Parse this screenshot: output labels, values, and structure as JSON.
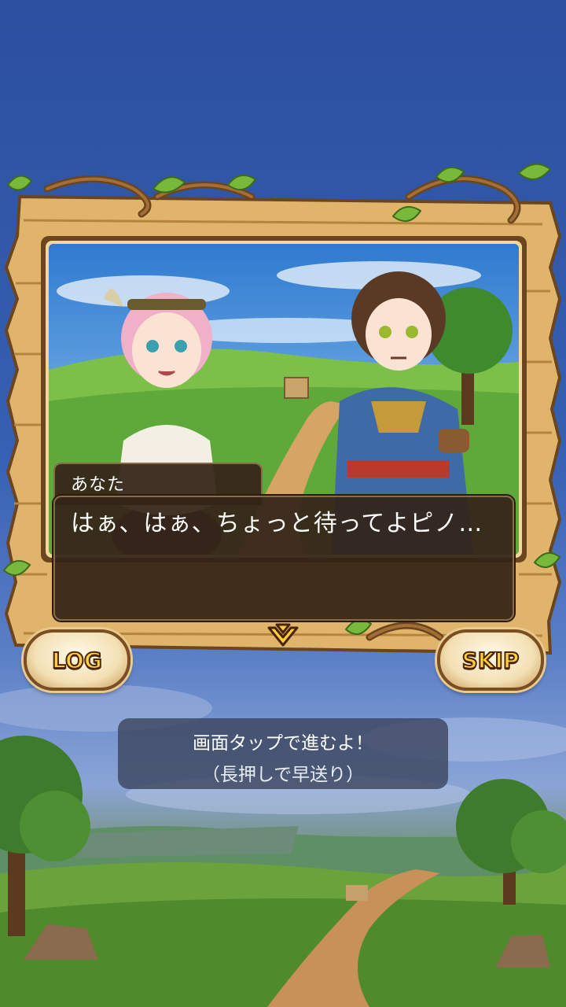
{
  "dialog": {
    "speaker": "あなた",
    "text": "はぁ、はぁ、ちょっと待ってよピノ…"
  },
  "buttons": {
    "log": "LOG",
    "skip": "SKIP"
  },
  "hint": {
    "line1": "画面タップで進むよ！",
    "line2": "（長押しで早送り）"
  },
  "colors": {
    "sky": "#2f56a8",
    "wood": "#e0b46a",
    "dialog_bg": "#342418",
    "button_text": "#ffd23a"
  },
  "icons": [
    "next-arrow-icon",
    "leaf-icon",
    "vine-icon"
  ]
}
